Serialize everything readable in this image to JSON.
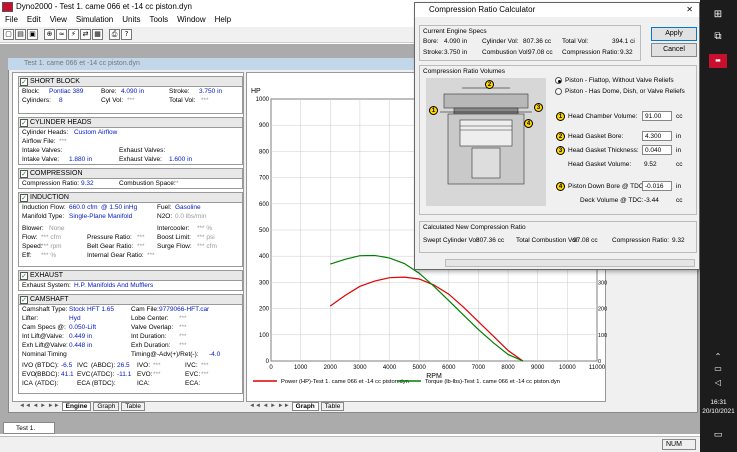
{
  "app": {
    "title": "Dyno2000 - Test 1. came 066 et -14 cc piston.dyn",
    "child_title": "Test 1. came 066 et -14 cc piston.dyn",
    "task_item": "Test 1. came...",
    "status_num": "NUM"
  },
  "menu": [
    "File",
    "Edit",
    "View",
    "Simulation",
    "Units",
    "Tools",
    "Window",
    "Help"
  ],
  "toolbar_icons": [
    "new-icon",
    "open-icon",
    "save-icon",
    "calc-icon",
    "flow-icon",
    "run-icon",
    "compare-icon",
    "table-icon",
    "print-icon",
    "help-icon"
  ],
  "short_block": {
    "title": "SHORT BLOCK",
    "block_l": "Block:",
    "block_v": "Pontiac 389",
    "bore_l": "Bore:",
    "bore_v": "4.090 in",
    "stroke_l": "Stroke:",
    "stroke_v": "3.750 in",
    "cyl_l": "Cylinders:",
    "cyl_v": "8",
    "cylvol_l": "Cyl Vol:",
    "cylvol_v": "***",
    "totvol_l": "Total Vol:",
    "totvol_v": "***"
  },
  "heads": {
    "title": "CYLINDER HEADS",
    "ch_l": "Cylinder Heads:",
    "ch_v": "Custom Airflow",
    "af_l": "Airflow File:",
    "af_v": "***",
    "iv_l": "Intake Valves:",
    "ev_l": "Exhaust Valves:",
    "ivs_l": "Intake Valve:",
    "ivs_v": "1.880 in",
    "evs_l": "Exhaust Valve:",
    "evs_v": "1.600 in"
  },
  "compression": {
    "title": "COMPRESSION",
    "cr_l": "Compression Ratio:",
    "cr_v": "9.32",
    "cs_l": "Combustion Space:",
    "cs_v": "***"
  },
  "induction": {
    "title": "INDUCTION",
    "if_l": "Induction Flow:",
    "if_v": "660.0 cfm",
    "at_v": "@ 1.50 inHg",
    "fuel_l": "Fuel:",
    "fuel_v": "Gasoline",
    "mt_l": "Manifold Type:",
    "mt_v": "Single-Plane Manifold",
    "n2o_l": "N2O:",
    "n2o_v": "0.0 lbs/min",
    "bl_l": "Blower:",
    "bl_v": "None",
    "ic_l": "Intercooler:",
    "ic_v": "*** %",
    "fl_l": "Flow:",
    "fl_v": "*** cfm",
    "pr_l": "Pressure Ratio:",
    "pr_v": "***",
    "bst_l": "Boost Limit:",
    "bst_v": "*** psi",
    "sp_l": "Speed:",
    "sp_v": "*** rpm",
    "bg_l": "Belt Gear Ratio:",
    "bg_v": "***",
    "sf_l": "Surge Flow:",
    "sf_v": "*** cfm",
    "ef_l": "Eff:",
    "ef_v": "*** %",
    "ig_l": "Internal Gear Ratio:",
    "ig_v": "***"
  },
  "exhaust": {
    "title": "EXHAUST",
    "es_l": "Exhaust System:",
    "es_v": "H.P. Manifolds And Mufflers"
  },
  "cam": {
    "title": "CAMSHAFT",
    "ct_l": "Camshaft Type:",
    "ct_v": "Stock HFT 1.65",
    "cf_l": "Cam File:",
    "cf_v": "9779066-HFT.car",
    "lf_l": "Lifter:",
    "lf_v": "Hyd",
    "lc_l": "Lobe Center:",
    "lc_v": "***",
    "cs_l": "Cam Specs @:",
    "cs_v": "0.050-Lift",
    "vo_l": "Valve Overlap:",
    "vo_v": "***",
    "il_l": "Int Lift@Valve:",
    "il_v": "0.449 in",
    "id_l": "Int Duration:",
    "id_v": "***",
    "el_l": "Exh Lift@Valve:",
    "el_v": "0.448 in",
    "ed_l": "Exh Duration:",
    "ed_v": "***",
    "nt_l": "Nominal Timing",
    "ta_l": "Timing@-Adv(+)/Ret(-):",
    "ta_v": "-4.0",
    "ivo_l": "IVO",
    "ivo_u": "(BTDC):",
    "ivo_v": "-6.5",
    "ivc_l": "IVC",
    "ivc_u": "(ABDC):",
    "ivc_v": "26.5",
    "ivo2_l": "IVO:",
    "ivo2_v": "***",
    "ivc2_l": "IVC:",
    "ivc2_v": "***",
    "evo_l": "EVO",
    "evo_u": "(BBDC):",
    "evo_v": "41.1",
    "evc_l": "EVC",
    "evc_u": "(ATDC):",
    "evc_v": "-11.1",
    "evo2_l": "EVO:",
    "evo2_v": "***",
    "evc2_l": "EVC:",
    "evc2_v": "***",
    "ica_l": "ICA",
    "ica_u": "(ATDC):",
    "eca_l": "ECA (BTDC):",
    "ica2_l": "ICA:",
    "eca2_l": "ECA:"
  },
  "left_tabs": [
    "Engine",
    "Graph",
    "Table"
  ],
  "graph_tabs": [
    "Graph",
    "Table"
  ],
  "chart_data": {
    "type": "line",
    "ylabel": "HP",
    "y2label": "Lbs-Ft",
    "xlabel": "RPM",
    "xlim": [
      0,
      11000
    ],
    "ylim": [
      0,
      1000
    ],
    "y2lim": [
      0,
      1000
    ],
    "xticks": [
      0,
      1000,
      2000,
      3000,
      4000,
      5000,
      6000,
      7000,
      8000,
      9000,
      10000,
      11000
    ],
    "yticks": [
      0,
      100,
      200,
      300,
      400,
      500,
      600,
      700,
      800,
      900,
      1000
    ],
    "y2ticks": [
      0,
      100,
      200,
      300,
      400,
      500,
      600,
      700,
      800,
      900,
      1000
    ],
    "series": [
      {
        "name": "Power (HP)-Test 1. came 066 et -14 cc piston.dyn",
        "color": "#e00000",
        "x": [
          2000,
          2500,
          3000,
          3500,
          4000,
          4500,
          5000,
          5500,
          6000,
          6500,
          7000,
          7500,
          8000,
          8500
        ],
        "y": [
          210,
          250,
          285,
          305,
          318,
          320,
          313,
          290,
          255,
          205,
          150,
          95,
          40,
          0
        ]
      },
      {
        "name": "Torque (lb-lbs)-Test 1. came 066 et -14 cc piston.dyn",
        "color": "#008000",
        "x": [
          2000,
          2500,
          3000,
          3500,
          4000,
          4500,
          5000,
          5500,
          6000,
          6500,
          7000,
          7500,
          8000,
          8500
        ],
        "y": [
          370,
          388,
          402,
          403,
          393,
          372,
          335,
          285,
          230,
          175,
          120,
          70,
          25,
          0
        ]
      }
    ]
  },
  "dialog": {
    "title": "Compression Ratio Calculator",
    "close": "✕",
    "apply": "Apply",
    "cancel": "Cancel",
    "cur_title": "Current Engine Specs",
    "bore_l": "Bore:",
    "bore_v": "4.090 in",
    "cylvol_l": "Cylinder Vol:",
    "cylvol_v": "807.36 cc",
    "totvol_l": "Total Vol:",
    "totvol_v": "394.1 ci",
    "stroke_l": "Stroke:",
    "stroke_v": "3.750 in",
    "comb_l": "Combustion Vol:",
    "comb_v": "97.08 cc",
    "cr_l": "Compression Ratio:",
    "cr_v": "9.32",
    "vol_title": "Compression Ratio Volumes",
    "r1": "Piston - Flattop, Without Valve Reliefs",
    "r2": "Piston - Has Dome, Dish, or Valve Reliefs",
    "hc_l": "Head Chamber Volume:",
    "hc_v": "91.00",
    "hc_u": "cc",
    "gb_l": "Head Gasket Bore:",
    "gb_v": "4.300",
    "gb_u": "in",
    "gt_l": "Head Gasket Thickness:",
    "gt_v": "0.040",
    "gt_u": "in",
    "gv_l": "Head Gasket Volume:",
    "gv_v": "9.52",
    "gv_u": "cc",
    "pd_l": "Piston Down Bore @ TDC:",
    "pd_v": "-0.016",
    "pd_u": "in",
    "dv_l": "Deck Volume @ TDC:",
    "dv_v": "-3.44",
    "dv_u": "cc",
    "calc_title": "Calculated New Compression Ratio",
    "sw_l": "Swept Cylinder Vol:",
    "sw_v": "807.36 cc",
    "tc_l": "Total Combustion Vol:",
    "tc_v": "97.08 cc",
    "ncr_l": "Compression Ratio:",
    "ncr_v": "9.32",
    "n1": "1",
    "n2": "2",
    "n3": "3",
    "n4": "4"
  },
  "taskbar": {
    "time": "16:31",
    "date": "20/10/2021"
  }
}
